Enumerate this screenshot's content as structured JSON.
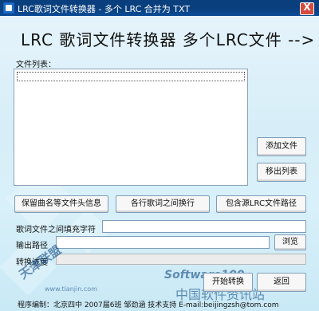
{
  "window": {
    "title": "LRC歌词文件转换器 - 多个 LRC 合并为 TXT",
    "close_glyph": "X"
  },
  "main": {
    "heading": "LRC 歌词文件转换器 多个LRC文件 --> TXT",
    "file_list_label": "文件列表："
  },
  "buttons": {
    "add_file": "添加文件",
    "remove_list": "移出列表",
    "keep_header": "保留曲名等文件头信息",
    "line_break": "各行歌词之间换行",
    "include_path": "包含源LRC文件路径",
    "browse": "浏览",
    "start": "开始转换",
    "back": "返回"
  },
  "fields": {
    "fill_label": "歌词文件之间填充字符",
    "fill_value": "",
    "output_label": "输出路径",
    "output_value": "",
    "progress_label": "转换进度",
    "progress_value": 0
  },
  "footer": {
    "text": "程序编制：北京四中 2007届6班 邹劲涵   技术支持 E-mail:beijingzsh@tom.com"
  },
  "watermarks": {
    "site_main": "Software100",
    "site_cn": "中国软件资讯站",
    "site_url": "www.tianjin.com",
    "badge": "天津联盟"
  }
}
